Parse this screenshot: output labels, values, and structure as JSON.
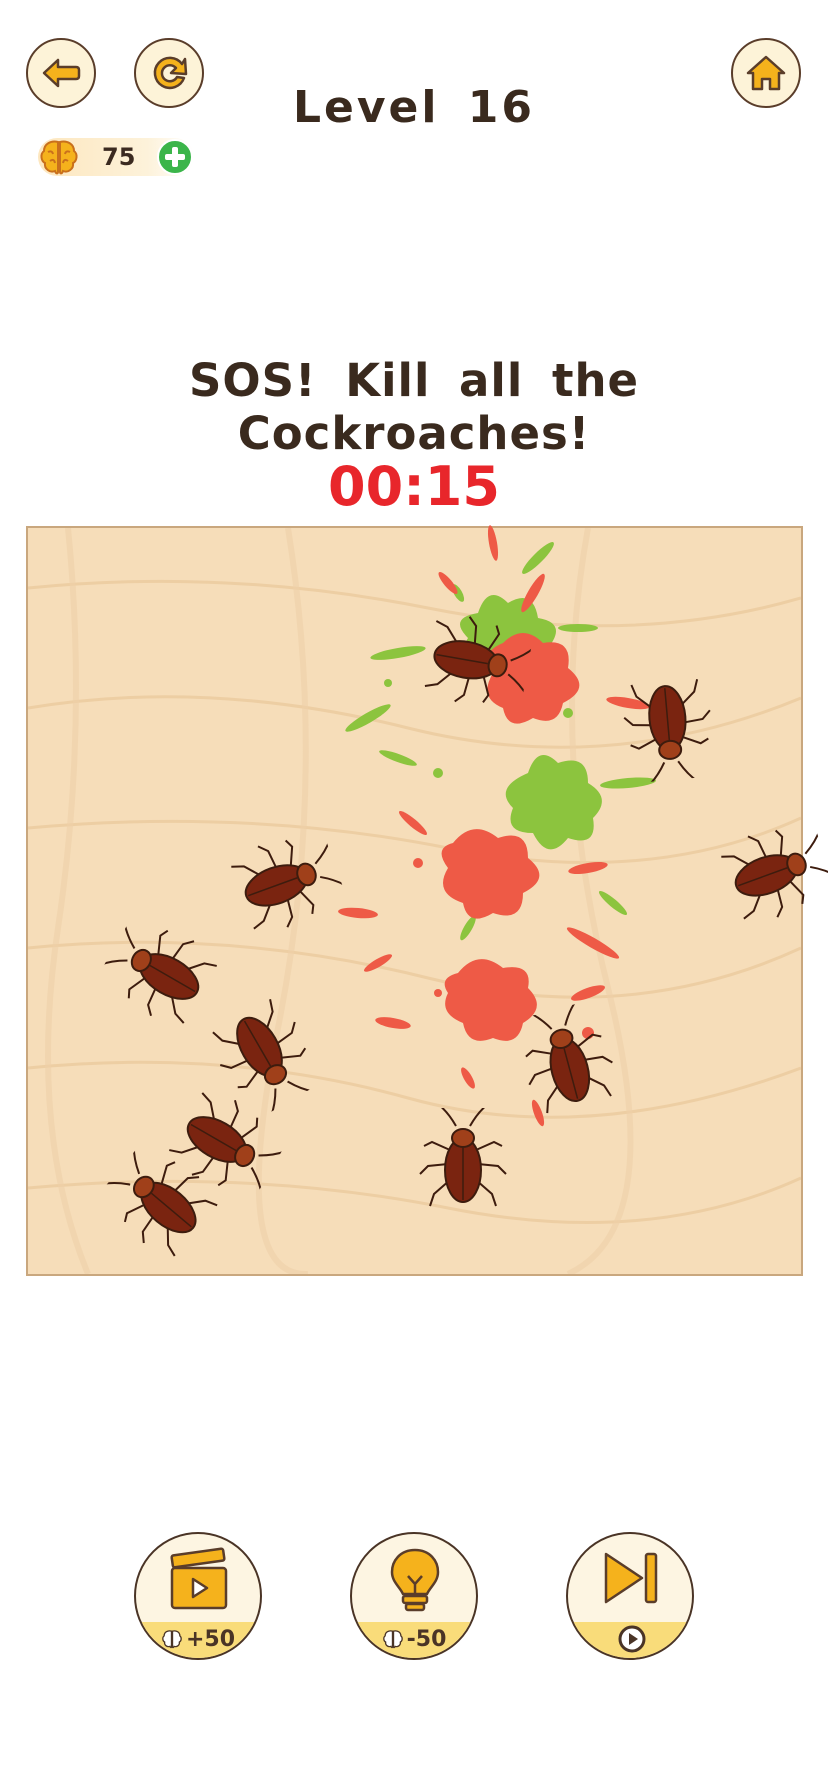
{
  "header": {
    "level_title": "Level 16",
    "brain_count": "75",
    "back_icon": "back-arrow-icon",
    "restart_icon": "restart-icon",
    "home_icon": "home-icon"
  },
  "task": {
    "instruction": "SOS! Kill all the Cockroaches!",
    "timer": "00:15"
  },
  "powerups": {
    "video_label": "+50",
    "hint_label": "-50",
    "skip_icon": "skip-icon"
  },
  "colors": {
    "accent": "#f5b21c",
    "timer": "#e8262b",
    "text": "#3a2a1e",
    "splat_red": "#ee5a46",
    "splat_green": "#8cc43e",
    "board": "#f7dfbd"
  }
}
